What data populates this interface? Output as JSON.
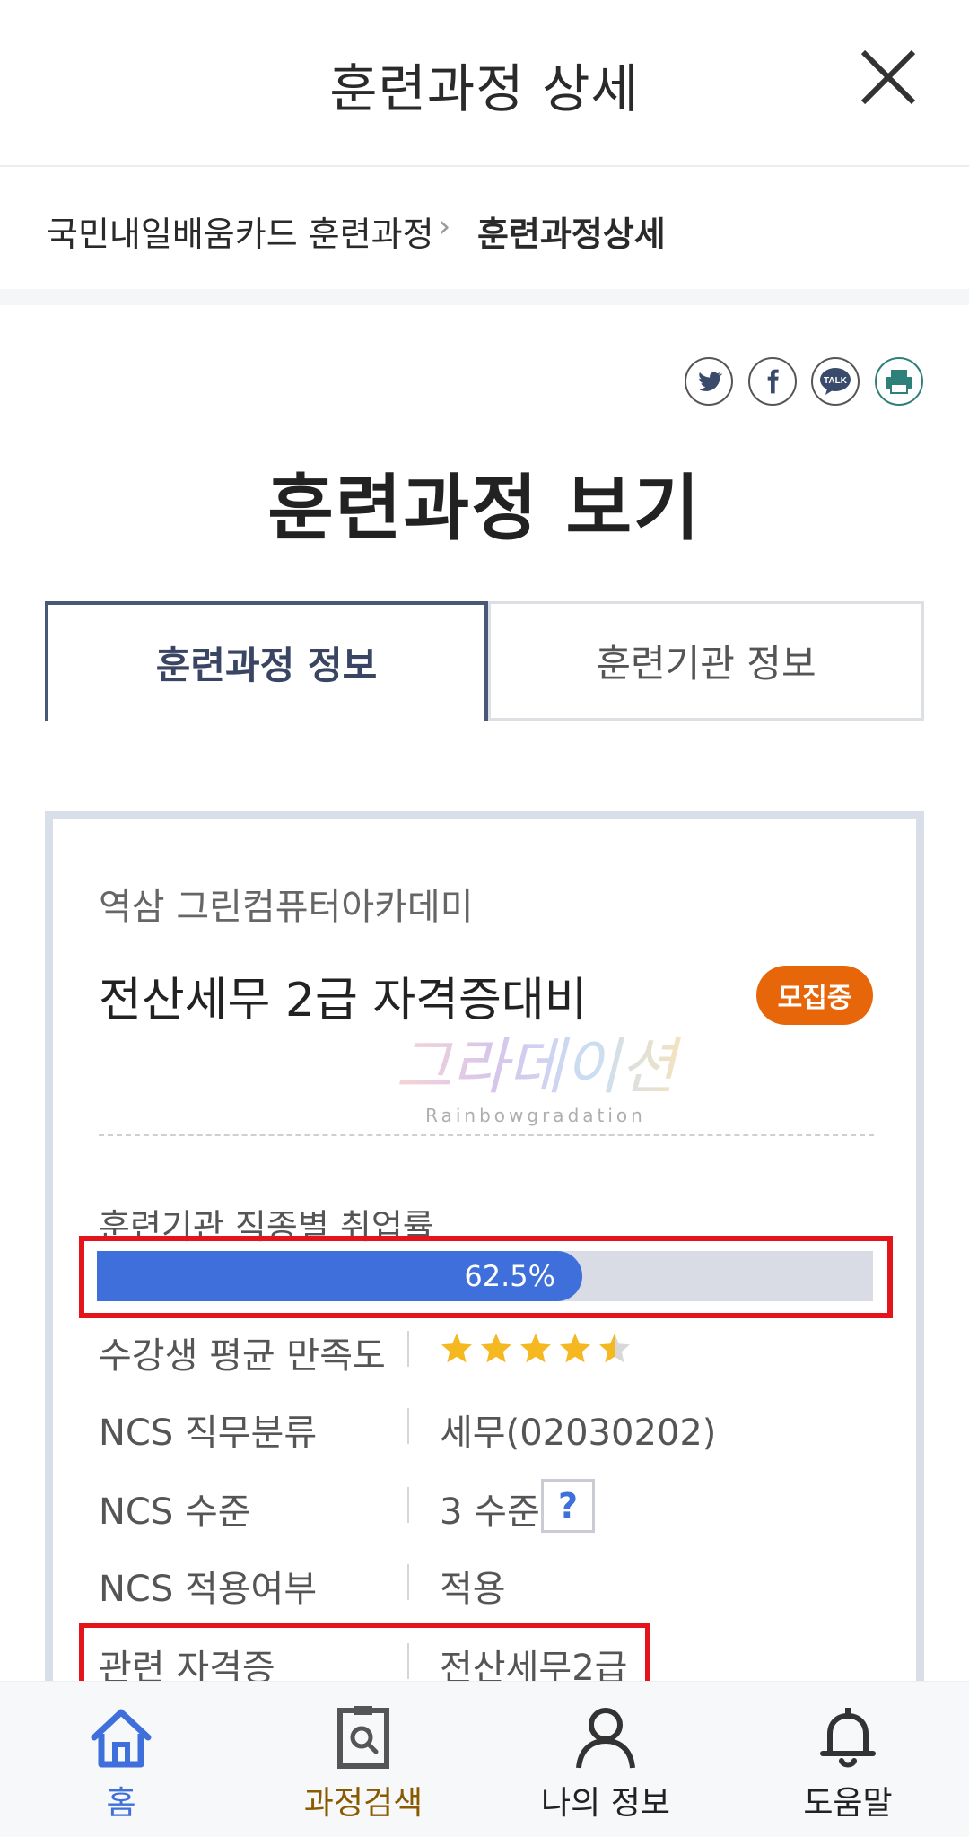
{
  "header": {
    "title": "훈련과정 상세"
  },
  "breadcrumb": {
    "parent": "국민내일배움카드 훈련과정",
    "separator": "›",
    "current": "훈련과정상세"
  },
  "share_icons": [
    "twitter-icon",
    "facebook-icon",
    "kakaotalk-icon",
    "print-icon"
  ],
  "share_talk_text": "TALK",
  "page_title": "훈련과정 보기",
  "tabs": [
    {
      "label": "훈련과정 정보",
      "active": true
    },
    {
      "label": "훈련기관 정보",
      "active": false
    }
  ],
  "course": {
    "institution": "역삼 그린컴퓨터아카데미",
    "name": "전산세무 2급 자격증대비",
    "status_badge": "모집중"
  },
  "watermark": {
    "main": "그라데이션",
    "sub": "Rainbowgradation"
  },
  "employment": {
    "label": "훈련기관 직종별 취업률",
    "value_text": "62.5%",
    "percent": 62.5
  },
  "details": {
    "satisfaction_label": "수강생 평균 만족도",
    "satisfaction_stars": 4.5,
    "satisfaction_max": 5,
    "ncs_class_label": "NCS 직무분류",
    "ncs_class_value": "세무(02030202)",
    "ncs_level_label": "NCS 수준",
    "ncs_level_value": "3 수준",
    "ncs_level_help": "?",
    "ncs_applied_label": "NCS 적용여부",
    "ncs_applied_value": "적용",
    "cert_label": "관련 자격증",
    "cert_value": "전산세무2급"
  },
  "bottom_nav": {
    "home": "홈",
    "search": "과정검색",
    "my_info": "나의 정보",
    "help": "도움말"
  },
  "colors": {
    "accent_blue": "#3e6fdb",
    "badge_orange": "#e8660a",
    "highlight_red": "#e4141b",
    "tab_border": "#4a5877"
  }
}
